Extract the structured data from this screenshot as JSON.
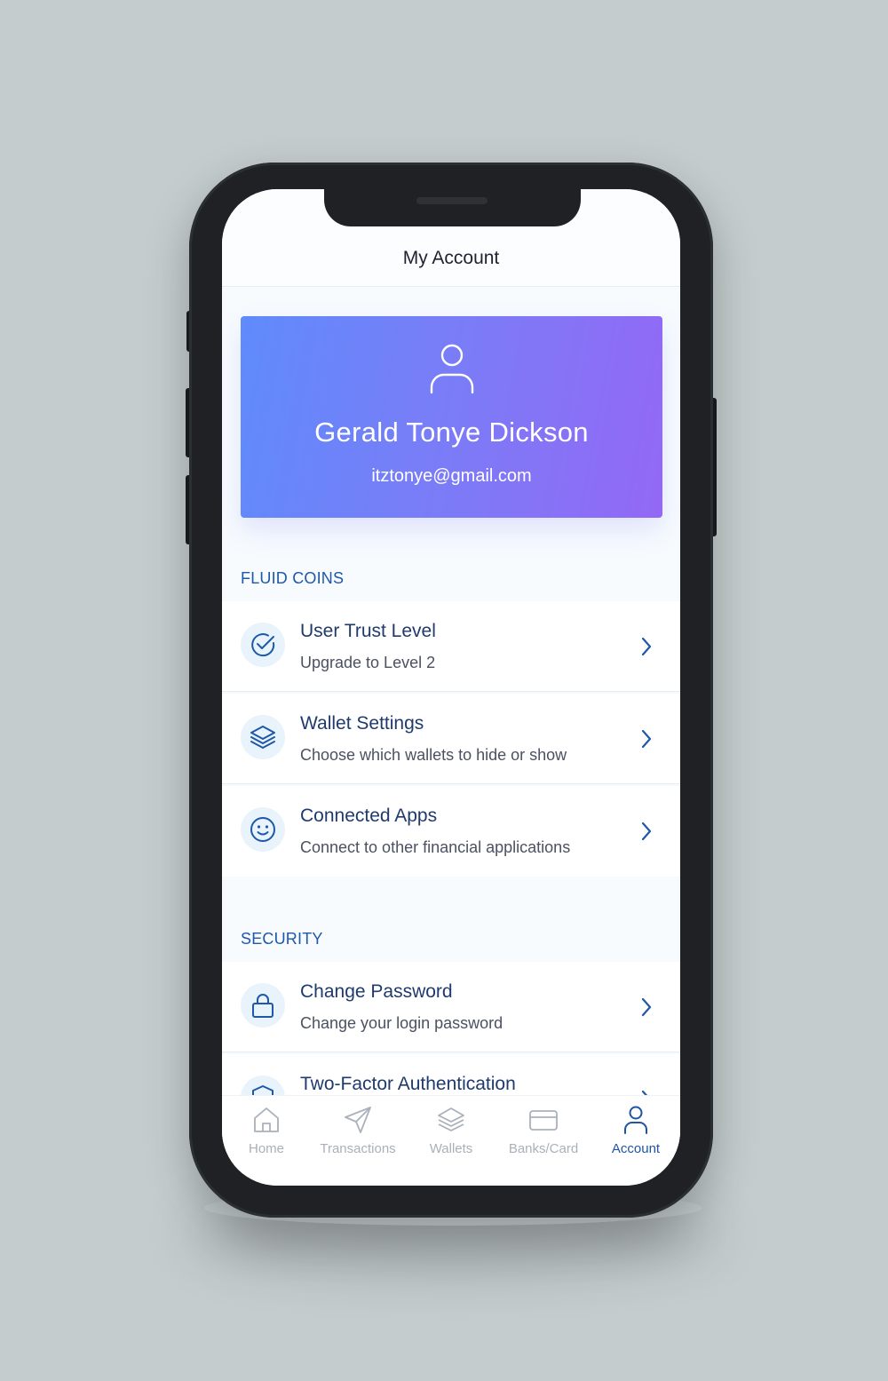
{
  "header": {
    "title": "My Account"
  },
  "profile": {
    "name": "Gerald Tonye Dickson",
    "email": "itztonye@gmail.com"
  },
  "sections": {
    "fluid_coins": {
      "label": "FLUID COINS",
      "items": [
        {
          "title": "User Trust Level",
          "subtitle": "Upgrade to Level 2",
          "icon": "check-circle-icon"
        },
        {
          "title": "Wallet Settings",
          "subtitle": "Choose which wallets to hide or show",
          "icon": "layers-icon"
        },
        {
          "title": "Connected Apps",
          "subtitle": "Connect to other financial applications",
          "icon": "smiley-icon"
        }
      ]
    },
    "security": {
      "label": "SECURITY",
      "items": [
        {
          "title": "Change Password",
          "subtitle": "Change your login password",
          "icon": "lock-icon"
        },
        {
          "title": "Two-Factor Authentication",
          "subtitle": "",
          "icon": "shield-icon"
        }
      ]
    }
  },
  "tabbar": {
    "tabs": [
      {
        "label": "Home",
        "icon": "home-icon"
      },
      {
        "label": "Transactions",
        "icon": "send-icon"
      },
      {
        "label": "Wallets",
        "icon": "layers-icon"
      },
      {
        "label": "Banks/Card",
        "icon": "card-icon"
      },
      {
        "label": "Account",
        "icon": "user-icon",
        "active": true
      }
    ]
  },
  "colors": {
    "accent": "#1e58a8",
    "gradient_start": "#5f8bfb",
    "gradient_end": "#9368f5",
    "background": "#c4cccd"
  }
}
